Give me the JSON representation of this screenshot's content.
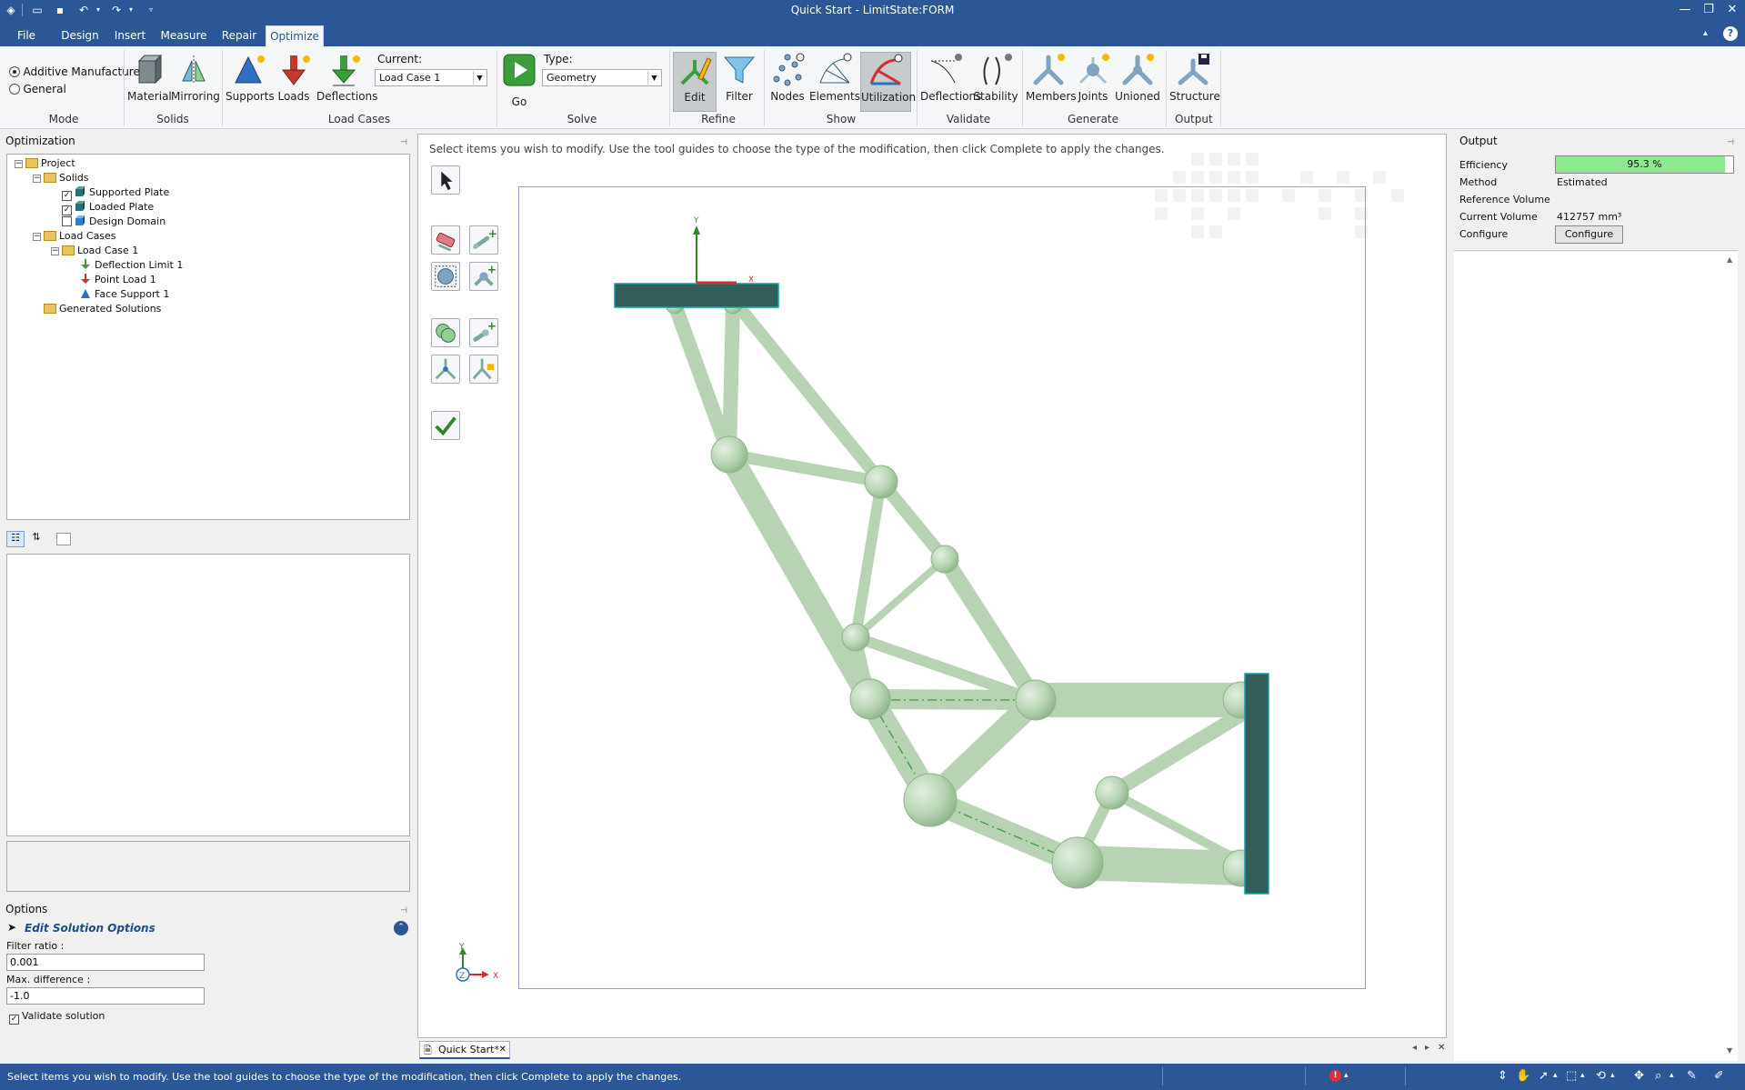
{
  "app": {
    "title": "Quick Start - LimitState:FORM"
  },
  "menu": {
    "tabs": [
      "File",
      "Design",
      "Insert",
      "Measure",
      "Repair",
      "Optimize"
    ],
    "active": "Optimize"
  },
  "ribbon": {
    "mode": {
      "options": [
        "Additive Manufacture",
        "General"
      ],
      "selected": "Additive Manufacture",
      "label": "Mode"
    },
    "solids": {
      "buttons": [
        "Material",
        "Mirroring"
      ],
      "label": "Solids"
    },
    "load_cases": {
      "buttons": [
        "Supports",
        "Loads",
        "Deflections"
      ],
      "current_label": "Current:",
      "current_value": "Load Case 1",
      "label": "Load Cases"
    },
    "solve": {
      "go": "Go",
      "type_label": "Type:",
      "type_value": "Geometry",
      "label": "Solve"
    },
    "refine": {
      "buttons": [
        "Edit",
        "Filter"
      ],
      "label": "Refine"
    },
    "show": {
      "buttons": [
        "Nodes",
        "Elements",
        "Utilization"
      ],
      "label": "Show"
    },
    "validate": {
      "buttons": [
        "Deflections",
        "Stability"
      ],
      "label": "Validate"
    },
    "generate": {
      "buttons": [
        "Members",
        "Joints",
        "Unioned"
      ],
      "label": "Generate"
    },
    "output": {
      "buttons": [
        "Structure"
      ],
      "label": "Output"
    }
  },
  "optimization_panel": {
    "title": "Optimization",
    "tree": {
      "project": "Project",
      "solids": "Solids",
      "supported_plate": "Supported Plate",
      "loaded_plate": "Loaded Plate",
      "design_domain": "Design Domain",
      "load_cases": "Load Cases",
      "load_case_1": "Load Case 1",
      "deflection_limit": "Deflection Limit 1",
      "point_load": "Point Load 1",
      "face_support": "Face Support 1",
      "generated_solutions": "Generated Solutions"
    }
  },
  "options_panel": {
    "title": "Options",
    "section": "Edit Solution Options",
    "filter_ratio_label": "Filter ratio :",
    "filter_ratio_value": "0.001",
    "max_difference_label": "Max. difference :",
    "max_difference_value": "-1.0",
    "validate_label": "Validate solution",
    "validate_checked": true
  },
  "viewport": {
    "instruction": "Select items you wish to modify.  Use the tool guides to choose the type of the modification, then click Complete to apply the changes.",
    "doc_tab": "Quick Start*",
    "axes": {
      "y": "Y",
      "x": "X",
      "z": "Z"
    }
  },
  "output_panel": {
    "title": "Output",
    "rows": [
      {
        "label": "Efficiency",
        "value": "95.3 %"
      },
      {
        "label": "Method",
        "value": "Estimated"
      },
      {
        "label": "Reference Volume",
        "value": ""
      },
      {
        "label": "Current Volume",
        "value": "412757 mm³"
      },
      {
        "label": "Configure",
        "value": "Configure"
      }
    ],
    "efficiency_fraction": 0.953
  },
  "status": {
    "text": "Select items you wish to modify.  Use the tool guides to choose the type of the modification, then click Complete to apply the changes."
  },
  "colors": {
    "chrome": "#2b5797",
    "member": "#c5dcc2",
    "plate": "#325e5a",
    "efficiency_bar": "#8ee88e"
  }
}
